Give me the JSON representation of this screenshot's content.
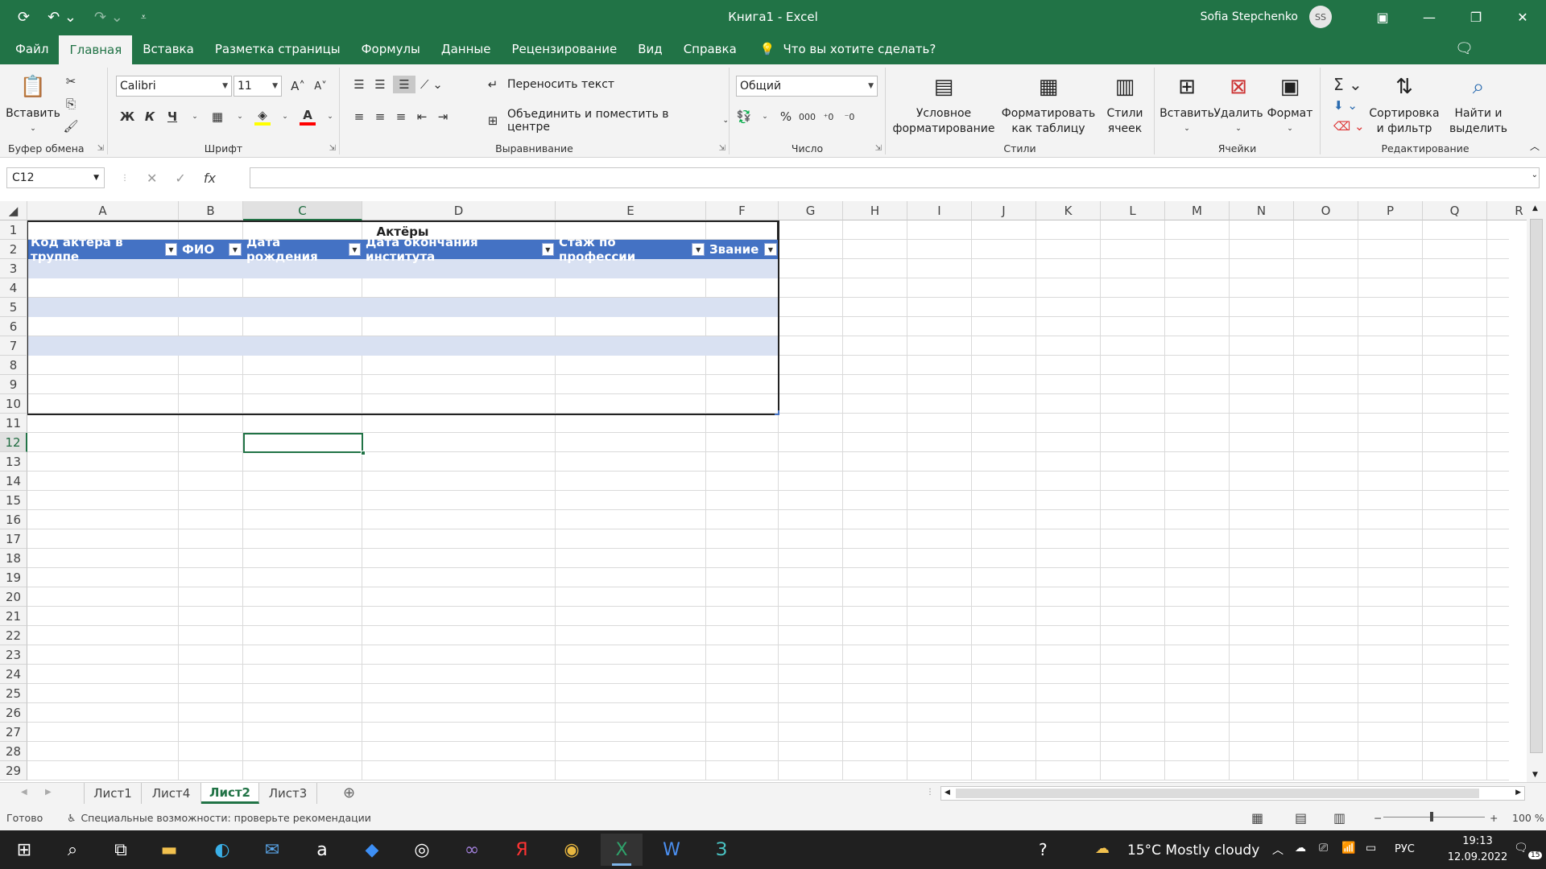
{
  "window": {
    "title": "Книга1  -  Excel",
    "user": "Sofia Stepchenko",
    "avatar_initials": "SS"
  },
  "menu": {
    "tabs": [
      "Файл",
      "Главная",
      "Вставка",
      "Разметка страницы",
      "Формулы",
      "Данные",
      "Рецензирование",
      "Вид",
      "Справка"
    ],
    "tell_me": "Что вы хотите сделать?"
  },
  "ribbon": {
    "clipboard": {
      "paste": "Вставить",
      "label": "Буфер обмена"
    },
    "font": {
      "name": "Calibri",
      "size": "11",
      "bold": "Ж",
      "italic": "К",
      "underline": "Ч",
      "label": "Шрифт"
    },
    "alignment": {
      "wrap": "Переносить текст",
      "merge": "Объединить и поместить в центре",
      "label": "Выравнивание"
    },
    "number": {
      "format": "Общий",
      "label": "Число"
    },
    "styles": {
      "conditional": "Условное форматирование",
      "as_table": "Форматировать как таблицу",
      "cell_styles": "Стили ячеек",
      "label": "Стили"
    },
    "cells": {
      "insert": "Вставить",
      "delete": "Удалить",
      "format": "Формат",
      "label": "Ячейки"
    },
    "editing": {
      "sort": "Сортировка и фильтр",
      "find": "Найти и выделить",
      "label": "Редактирование"
    }
  },
  "formula_bar": {
    "name_box": "C12",
    "fx": "fx",
    "value": ""
  },
  "sheet": {
    "columns": [
      "A",
      "B",
      "C",
      "D",
      "E",
      "F",
      "G",
      "H",
      "I",
      "J",
      "K",
      "L",
      "M",
      "N",
      "O",
      "P",
      "Q",
      "R"
    ],
    "rows": [
      "1",
      "2",
      "3",
      "4",
      "5",
      "6",
      "7",
      "8",
      "9",
      "10",
      "11",
      "12",
      "13",
      "14",
      "15",
      "16",
      "17",
      "18",
      "19",
      "20",
      "21",
      "22",
      "23",
      "24",
      "25",
      "26",
      "27",
      "28",
      "29"
    ],
    "table_title": "Актёры",
    "table_headers": [
      "Код актёра в труппе",
      "ФИО",
      "Дата рождения",
      "Дата окончания института",
      "Стаж по профессии",
      "Звание"
    ],
    "selected_cell": "C12"
  },
  "sheet_tabs": [
    "Лист1",
    "Лист4",
    "Лист2",
    "Лист3"
  ],
  "active_sheet": "Лист2",
  "status": {
    "ready": "Готово",
    "accessibility": "Специальные возможности: проверьте рекомендации",
    "zoom": "100 %"
  },
  "taskbar": {
    "weather": "15°C  Mostly cloudy",
    "lang": "РУС",
    "time": "19:13",
    "date": "12.09.2022",
    "notifications": "15"
  }
}
